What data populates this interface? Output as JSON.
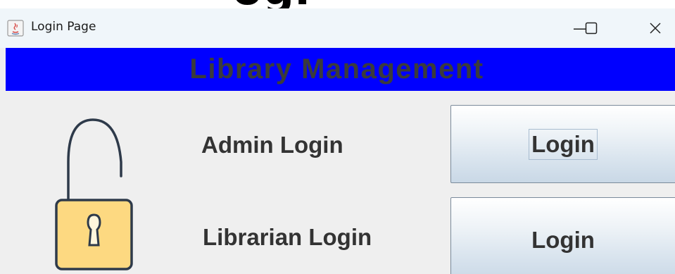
{
  "window": {
    "title": "Login Page",
    "minimize_glyph": "—",
    "close_glyph": "✕",
    "maximize_icon": "maximize-icon",
    "app_icon": "java-icon"
  },
  "background_peek_text": "ogi",
  "banner": {
    "text": "Library Management",
    "background": "#0000ff",
    "text_color": "#3b3b3b"
  },
  "lock_icon": "unlocked-padlock-icon",
  "rows": [
    {
      "label": "Admin Login",
      "button": "Login",
      "focused": true
    },
    {
      "label": "Librarian Login",
      "button": "Login",
      "focused": false
    }
  ]
}
